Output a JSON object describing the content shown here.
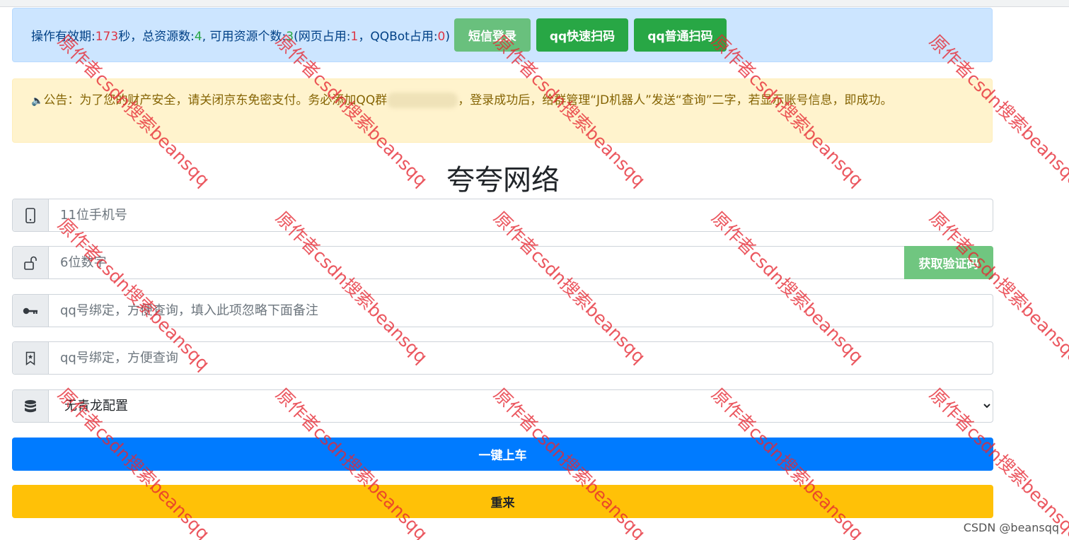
{
  "status_bar": {
    "label_validity": "操作有效期:",
    "validity_seconds": "173",
    "label_seconds_total": "秒，总资源数:",
    "total_resources": "4",
    "label_available": ", 可用资源个数:",
    "available_resources": "3",
    "label_web": "(网页占用:",
    "web_used": "1",
    "label_qqbot": "，QQBot占用:",
    "qqbot_used": "0",
    "label_close": ")",
    "buttons": [
      "短信登录",
      "qq快速扫码",
      "qq普通扫码"
    ]
  },
  "notice": {
    "icon": "speaker-icon",
    "text_before": "公告：为了您的财产安全，请关闭京东免密支付。务必添加QQ群",
    "text_after": "，登录成功后，给群管理“JD机器人”发送“查询”二字，若显示账号信息，即成功。"
  },
  "page_title": "夸夸网络",
  "form": {
    "phone_placeholder": "11位手机号",
    "code_placeholder": "6位数字",
    "get_code_label": "获取验证码",
    "qq_bind_placeholder": "qq号绑定，方便查询，填入此项忽略下面备注",
    "qq_remark_placeholder": "qq号绑定，方便查询",
    "qinglong_selected": "无青龙配置",
    "submit_label": "一键上车",
    "reset_label": "重来"
  },
  "watermark_text": "原作者csdn搜索beansqq",
  "credit": "CSDN @beansqq",
  "colors": {
    "info_bg": "#cce5ff",
    "warning_bg": "#fff3cd",
    "success": "#28a745",
    "primary": "#007bff",
    "warning": "#ffc107",
    "danger": "#dc3545"
  }
}
